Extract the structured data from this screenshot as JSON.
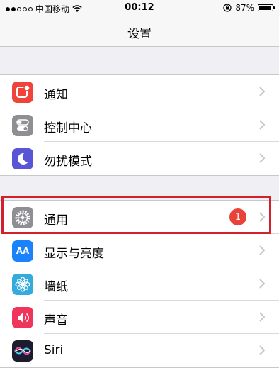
{
  "status_bar": {
    "carrier": "中国移动",
    "time": "00:12",
    "battery_percent": "87%",
    "battery_level": 0.87,
    "wifi_icon": "wifi-icon",
    "lock_icon": "orientation-lock-icon"
  },
  "nav": {
    "title": "设置"
  },
  "groups": [
    {
      "items": [
        {
          "label": "通知",
          "icon": "notifications-icon",
          "color": "#f0433a"
        },
        {
          "label": "控制中心",
          "icon": "control-center-icon",
          "color": "#8e8e93"
        },
        {
          "label": "勿扰模式",
          "icon": "do-not-disturb-icon",
          "color": "#5856d6"
        }
      ]
    },
    {
      "items": [
        {
          "label": "通用",
          "icon": "gear-icon",
          "color": "#8e8e93",
          "badge": "1"
        },
        {
          "label": "显示与亮度",
          "icon": "display-brightness-icon",
          "color": "#1a82fb",
          "icon_text": "AA"
        },
        {
          "label": "墙纸",
          "icon": "wallpaper-icon",
          "color": "#35aadc"
        },
        {
          "label": "声音",
          "icon": "sounds-icon",
          "color": "#f0355b"
        },
        {
          "label": "Siri",
          "icon": "siri-icon",
          "color": "#1c1c2e"
        }
      ]
    }
  ],
  "colors": {
    "background": "#efeff4",
    "badge": "#e8433a",
    "highlight_box": "#d41f2c"
  }
}
